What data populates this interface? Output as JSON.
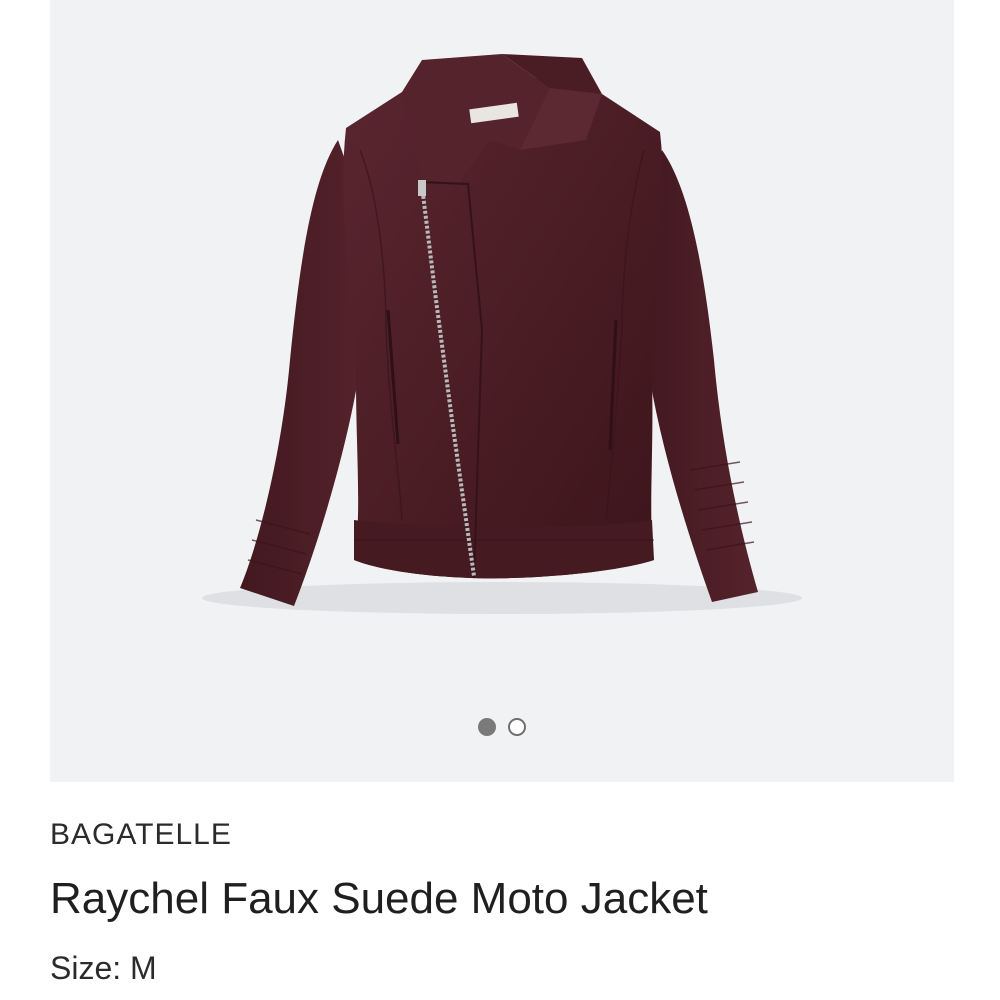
{
  "product": {
    "brand": "BAGATELLE",
    "name": "Raychel Faux Suede Moto Jacket",
    "size_label": "Size:",
    "size_value": "M",
    "jacket_color": "#4b1d24"
  },
  "gallery": {
    "background_color": "#f1f2f4",
    "image_count": 2,
    "active_index": 0
  }
}
